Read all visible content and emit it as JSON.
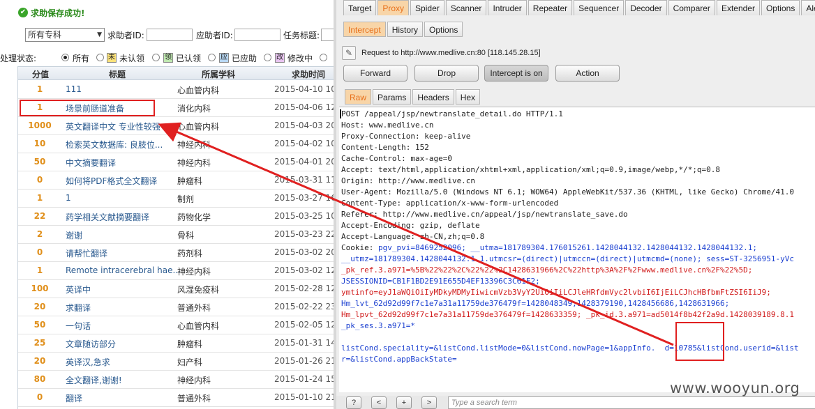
{
  "left": {
    "success_text": "求助保存成功!",
    "specialty_select": "所有专科",
    "seeker_label": "求助者ID:",
    "responder_label": "应助者ID:",
    "task_title_label": "任务标题:",
    "status_label": "处理状态:",
    "status_options": [
      {
        "label": "所有",
        "icon": ""
      },
      {
        "label": "未认领",
        "icon": "未"
      },
      {
        "label": "已认领",
        "icon": "领"
      },
      {
        "label": "已应助",
        "icon": "应"
      },
      {
        "label": "修改中",
        "icon": "改"
      }
    ],
    "columns": [
      "分值",
      "标题",
      "所属学科",
      "求助时间"
    ],
    "rows": [
      {
        "score": "1",
        "title": "111",
        "dept": "心血管内科",
        "date": "2015-04-10 10"
      },
      {
        "score": "1",
        "title": "场景前肠道准备",
        "dept": "消化内科",
        "date": "2015-04-06 12"
      },
      {
        "score": "1000",
        "title": "英文翻译中文 专业性较强",
        "dept": "心血管内科",
        "date": "2015-04-03 20"
      },
      {
        "score": "10",
        "title": "检索英文数据库: 良肢位...",
        "dept": "神经内科",
        "date": "2015-04-02 10"
      },
      {
        "score": "50",
        "title": "中文摘要翻译",
        "dept": "神经内科",
        "date": "2015-04-01 20"
      },
      {
        "score": "0",
        "title": "如何将PDF格式全文翻译",
        "dept": "肿瘤科",
        "date": "2015-03-31 11"
      },
      {
        "score": "1",
        "title": "1",
        "dept": "制剂",
        "date": "2015-03-27 16"
      },
      {
        "score": "22",
        "title": "药学相关文献摘要翻译",
        "dept": "药物化学",
        "date": "2015-03-25 10"
      },
      {
        "score": "2",
        "title": "谢谢",
        "dept": "骨科",
        "date": "2015-03-23 22"
      },
      {
        "score": "0",
        "title": "请帮忙翻译",
        "dept": "药剂科",
        "date": "2015-03-02 20"
      },
      {
        "score": "1",
        "title": "Remote intracerebral hae...",
        "dept": "神经内科",
        "date": "2015-03-02 12"
      },
      {
        "score": "100",
        "title": "英译中",
        "dept": "风湿免疫科",
        "date": "2015-02-28 12"
      },
      {
        "score": "20",
        "title": "求翻译",
        "dept": "普通外科",
        "date": "2015-02-22 23"
      },
      {
        "score": "50",
        "title": "一句话",
        "dept": "心血管内科",
        "date": "2015-02-05 12"
      },
      {
        "score": "25",
        "title": "文章随访部分",
        "dept": "肿瘤科",
        "date": "2015-01-31 14"
      },
      {
        "score": "20",
        "title": "英译汉,急求",
        "dept": "妇产科",
        "date": "2015-01-26 21"
      },
      {
        "score": "80",
        "title": "全文翻译,谢谢!",
        "dept": "神经内科",
        "date": "2015-01-24 15"
      },
      {
        "score": "0",
        "title": "翻译",
        "dept": "普通外科",
        "date": "2015-01-10 21"
      }
    ]
  },
  "burp": {
    "main_tabs": [
      "Target",
      "Proxy",
      "Spider",
      "Scanner",
      "Intruder",
      "Repeater",
      "Sequencer",
      "Decoder",
      "Comparer",
      "Extender",
      "Options",
      "Alerts"
    ],
    "active_main_tab": "Proxy",
    "sub_tabs": [
      "Intercept",
      "History",
      "Options"
    ],
    "request_info": "Request to http://www.medlive.cn:80  [118.145.28.15]",
    "buttons": {
      "forward": "Forward",
      "drop": "Drop",
      "intercept": "Intercept is on",
      "action": "Action"
    },
    "view_tabs": [
      "Raw",
      "Params",
      "Headers",
      "Hex"
    ],
    "request_lines": [
      "POST /appeal/jsp/newtranslate_detail.do HTTP/1.1",
      "Host: www.medlive.cn",
      "Proxy-Connection: keep-alive",
      "Content-Length: 152",
      "Cache-Control: max-age=0",
      "Accept: text/html,application/xhtml+xml,application/xml;q=0.9,image/webp,*/*;q=0.8",
      "Origin: http://www.medlive.cn",
      "User-Agent: Mozilla/5.0 (Windows NT 6.1; WOW64) AppleWebKit/537.36 (KHTML, like Gecko) Chrome/41.0",
      "Content-Type: application/x-www-form-urlencoded",
      "Referer: http://www.medlive.cn/appeal/jsp/newtranslate_save.do",
      "Accept-Encoding: gzip, deflate",
      "Accept-Language: zh-CN,zh;q=0.8"
    ],
    "cookie_label": "Cookie: ",
    "cookie_lines": [
      "pgv_pvi=8469252096; __utma=181789304.176015261.1428044132.1428044132.1428044132.1;",
      "__utmz=181789304.1428044132.1.1.utmcsr=(direct)|utmccn=(direct)|utmcmd=(none); sess=ST-3256951-yVc",
      "_pk_ref.3.a971=%5B%22%22%2C%22%22%2C1428631966%2C%22http%3A%2F%2Fwww.medlive.cn%2F%22%5D;",
      "JSESSIONID=CB1F1BD2E91E655D4EF13396C3C61F2;",
      "ymtinfo=eyJ1aWQiOiIyMDkyMDMyIiwicmVzb3VyY2UiOiIiLCJleHRfdmVyc2lvbiI6IjEiLCJhcHBfbmFtZSI6IiJ9;",
      "Hm_lvt_62d92d99f7c1e7a31a11759de376479f=1428048349,1428379190,1428456686,1428631966;",
      "Hm_lpvt_62d92d99f7c1e7a31a11759de376479f=1428633359; _pk_id.3.a971=ad5014f8b42f2a9d.1428039189.8.1",
      "_pk_ses.3.a971=*"
    ],
    "body_lines": [
      "listCond.speciality=&listCond.listMode=0&listCond.nowPage=1&appInfo.  d=10785&listCond.userid=&list",
      "r=&listCond.appBackState="
    ],
    "bottom_buttons": [
      "?",
      "<",
      "+",
      ">"
    ],
    "search_placeholder": "Type a search term"
  },
  "watermark": "www.wooyun.org"
}
